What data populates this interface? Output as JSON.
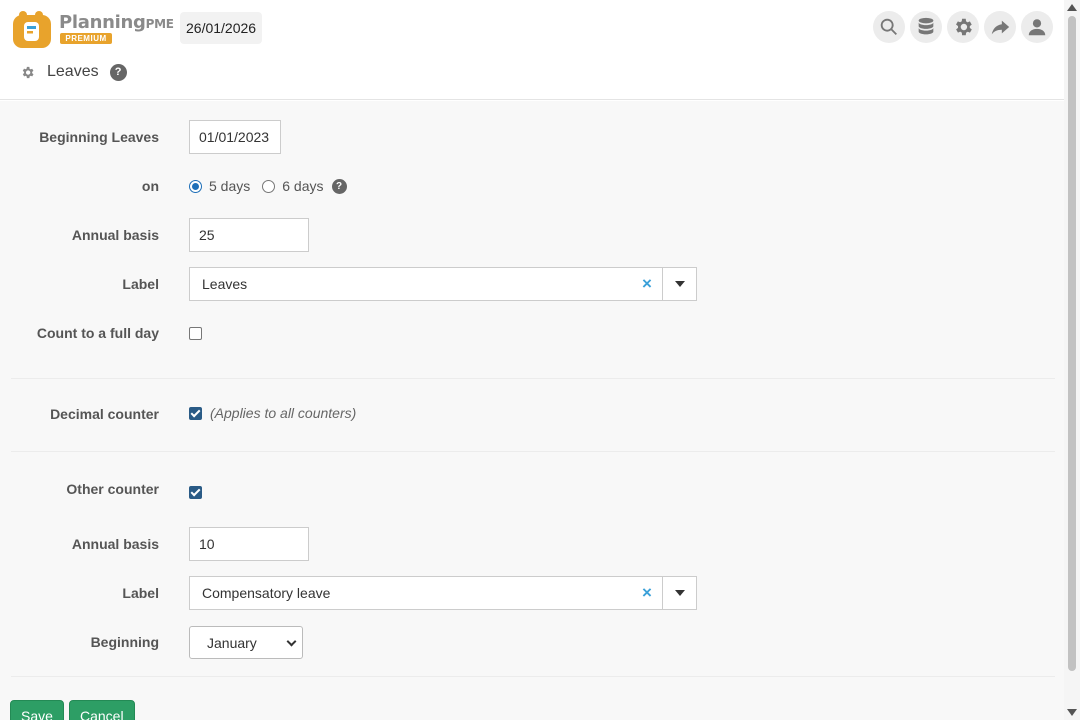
{
  "header": {
    "brand_name": "Planning",
    "brand_suffix": "PME",
    "brand_badge": "PREMIUM",
    "date": "26/01/2026",
    "icons": [
      "search-icon",
      "database-icon",
      "gear-icon",
      "share-icon",
      "user-icon"
    ]
  },
  "page": {
    "title": "Leaves",
    "help": "?"
  },
  "form": {
    "beginning_leaves": {
      "label": "Beginning Leaves",
      "value": "01/01/2023"
    },
    "on": {
      "label": "on",
      "options": [
        {
          "label": "5 days",
          "selected": true
        },
        {
          "label": "6 days",
          "selected": false
        }
      ],
      "help": "?"
    },
    "annual_basis": {
      "label": "Annual basis",
      "value": "25"
    },
    "label_field": {
      "label": "Label",
      "value": "Leaves",
      "clear": "×"
    },
    "count_full_day": {
      "label": "Count to a full day",
      "checked": false
    },
    "decimal_counter": {
      "label": "Decimal counter",
      "checked": true,
      "note": "(Applies to all counters)"
    },
    "other_counter": {
      "label": "Other counter",
      "checked": true
    },
    "other_annual_basis": {
      "label": "Annual basis",
      "value": "10"
    },
    "other_label": {
      "label": "Label",
      "value": "Compensatory leave",
      "clear": "×"
    },
    "beginning": {
      "label": "Beginning",
      "value": "January"
    }
  },
  "actions": {
    "save": "Save",
    "cancel": "Cancel"
  },
  "colors": {
    "brand_orange": "#e8a32c",
    "primary_button": "#2d9e65",
    "checkbox": "#2a5b86",
    "clear_x": "#3aa0d8"
  }
}
